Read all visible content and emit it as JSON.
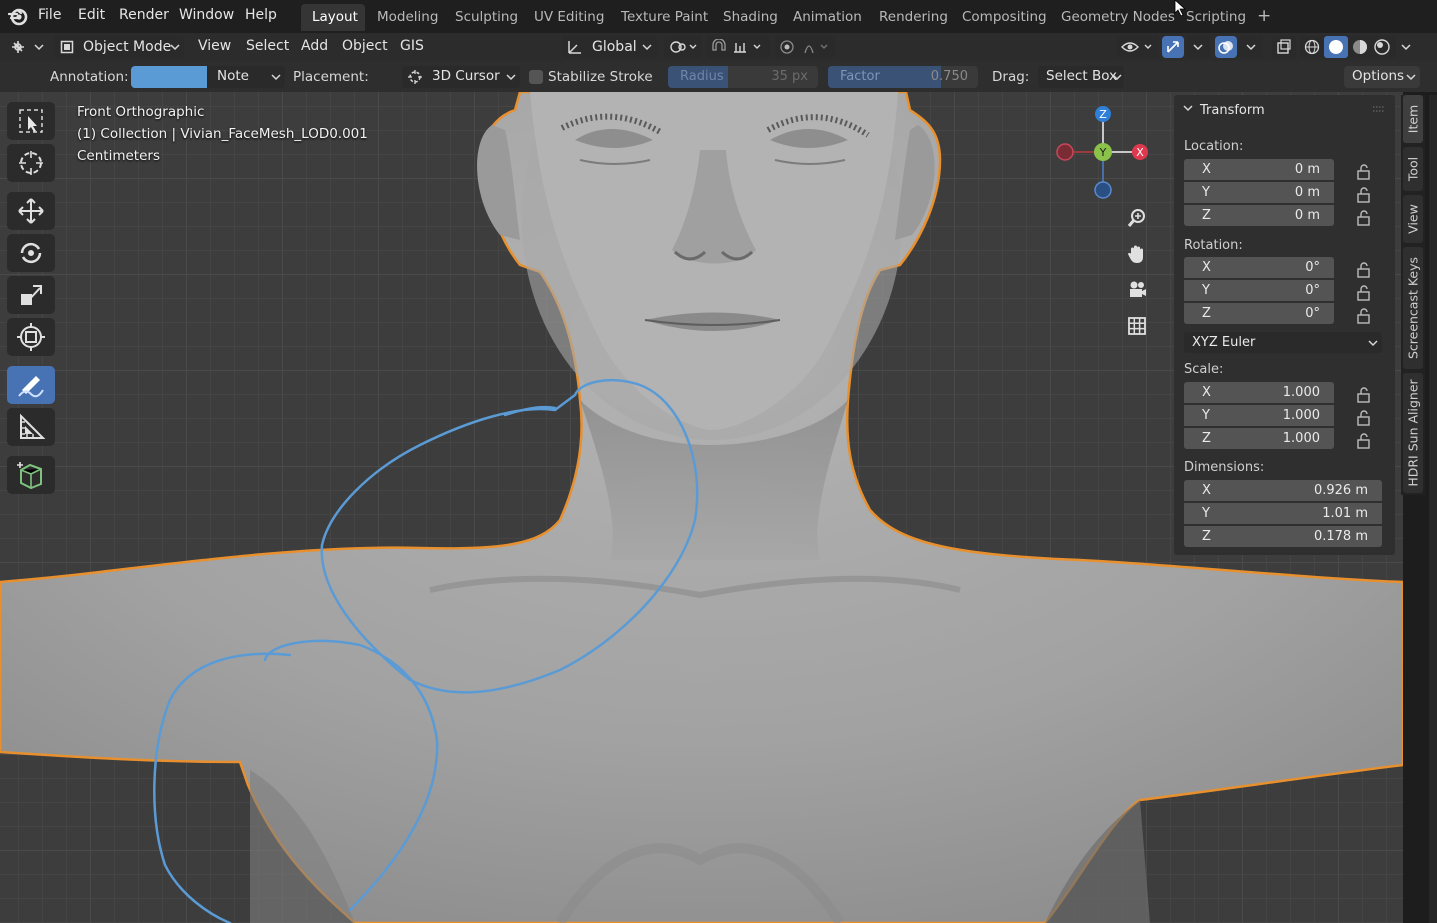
{
  "menus": [
    "File",
    "Edit",
    "Render",
    "Window",
    "Help"
  ],
  "workspaces": [
    "Layout",
    "Modeling",
    "Sculpting",
    "UV Editing",
    "Texture Paint",
    "Shading",
    "Animation",
    "Rendering",
    "Compositing",
    "Geometry Nodes",
    "Scripting"
  ],
  "active_workspace": "Layout",
  "add_workspace": "+",
  "header": {
    "mode": "Object Mode",
    "menu": [
      "View",
      "Select",
      "Add",
      "Object",
      "GIS"
    ],
    "orientation": "Global"
  },
  "tool_settings": {
    "annotation_label": "Annotation:",
    "annotation_color": "#5b9bd5",
    "layer": "Note",
    "placement_label": "Placement:",
    "placement": "3D Cursor",
    "stabilize": "Stabilize Stroke",
    "radius_label": "Radius",
    "radius_value": "35 px",
    "factor_label": "Factor",
    "factor_value": "0.750",
    "factor_fill": 0.75,
    "drag_label": "Drag:",
    "drag_value": "Select Box",
    "options": "Options"
  },
  "viewport": {
    "view_name": "Front Orthographic",
    "collection": "(1) Collection | Vivian_FaceMesh_LOD0.001",
    "units": "Centimeters"
  },
  "gizmo": {
    "z": "Z",
    "y": "Y",
    "x": "X"
  },
  "colors": {
    "selection_outline": "#e8902e",
    "annotation": "#5b9bd5",
    "active_tool": "#4772b3",
    "x_axis": "#e0394f",
    "y_axis": "#8bc34a",
    "z_axis": "#2f7fd6"
  },
  "transform": {
    "title": "Transform",
    "location_label": "Location:",
    "location": [
      {
        "axis": "X",
        "value": "0 m"
      },
      {
        "axis": "Y",
        "value": "0 m"
      },
      {
        "axis": "Z",
        "value": "0 m"
      }
    ],
    "rotation_label": "Rotation:",
    "rotation": [
      {
        "axis": "X",
        "value": "0°"
      },
      {
        "axis": "Y",
        "value": "0°"
      },
      {
        "axis": "Z",
        "value": "0°"
      }
    ],
    "rotation_mode": "XYZ Euler",
    "scale_label": "Scale:",
    "scale": [
      {
        "axis": "X",
        "value": "1.000"
      },
      {
        "axis": "Y",
        "value": "1.000"
      },
      {
        "axis": "Z",
        "value": "1.000"
      }
    ],
    "dimensions_label": "Dimensions:",
    "dimensions": [
      {
        "axis": "X",
        "value": "0.926 m"
      },
      {
        "axis": "Y",
        "value": "1.01 m"
      },
      {
        "axis": "Z",
        "value": "0.178 m"
      }
    ]
  },
  "sidebar_tabs": [
    "Item",
    "Tool",
    "View",
    "Screencast Keys",
    "HDRI Sun Aligner"
  ]
}
